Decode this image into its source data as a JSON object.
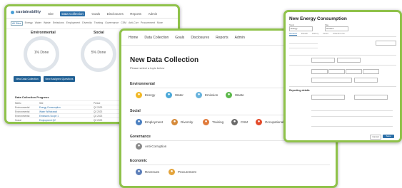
{
  "w1": {
    "logo": "sustainability",
    "nav": [
      "Site",
      "Data Collection",
      "Goals",
      "Disclosures",
      "Reports",
      "Admin"
    ],
    "nav_active": 1,
    "tabs": [
      "All Sites",
      "Energy",
      "Water",
      "Waste",
      "Emissions",
      "Employment",
      "Diversity",
      "Training",
      "Governance",
      "CSM",
      "Anti-Corr",
      "Procurement",
      "More"
    ],
    "env_title": "Environmental",
    "soc_title": "Social",
    "env_done": "1% Done",
    "soc_done": "5% Done",
    "btn_new": "New Data Collection",
    "btn_assign": "New Assigned Questions",
    "progress_title": "Data Collection Progress",
    "rows": [
      {
        "c1": "Metric",
        "c2": "Site",
        "c3": "Period",
        "c4": "Status"
      },
      {
        "c1": "Environmental",
        "c2": "Energy Consumption",
        "c3": "Q2 2023",
        "c4": "Assigned"
      },
      {
        "c1": "Environmental",
        "c2": "Water Withdrawal",
        "c3": "Q2 2023",
        "c4": "Assigned"
      },
      {
        "c1": "Environmental",
        "c2": "Emissions Scope 1",
        "c3": "Q2 2023",
        "c4": "Assigned"
      },
      {
        "c1": "Social",
        "c2": "Employment Q2",
        "c3": "Q2 2023",
        "c4": "In Progress"
      },
      {
        "c1": "Social",
        "c2": "Diversity Q2",
        "c3": "Q2 2023",
        "c4": "In Progress"
      }
    ]
  },
  "w2": {
    "nav": [
      "Home",
      "Data Collection",
      "Goals",
      "Disclosures",
      "Reports",
      "Admin"
    ],
    "title": "New Data Collection",
    "subtitle": "Please select a topic below",
    "env": {
      "heading": "Environmental",
      "items": [
        "Energy",
        "Water",
        "Emission",
        "Waste"
      ]
    },
    "soc": {
      "heading": "Social",
      "items": [
        "Employment",
        "Diversity",
        "Training",
        "CSM",
        "Occupational"
      ]
    },
    "gov": {
      "heading": "Governance",
      "items": [
        "Anti-Corruption"
      ]
    },
    "eco": {
      "heading": "Economic",
      "items": [
        "Revenues",
        "Procurement"
      ]
    }
  },
  "w3": {
    "title": "New Energy Consumption",
    "topic_label": "Topic",
    "topic_value": "Energy",
    "site_label": "Site",
    "site_value": "All sites",
    "tabs": [
      "General",
      "Details",
      "History",
      "Notes",
      "Attachments"
    ],
    "tab_active": 0,
    "section_detail": "Reporting details",
    "btn_cancel": "Cancel",
    "btn_save": "Save",
    "accent": "#2c6fa8"
  }
}
